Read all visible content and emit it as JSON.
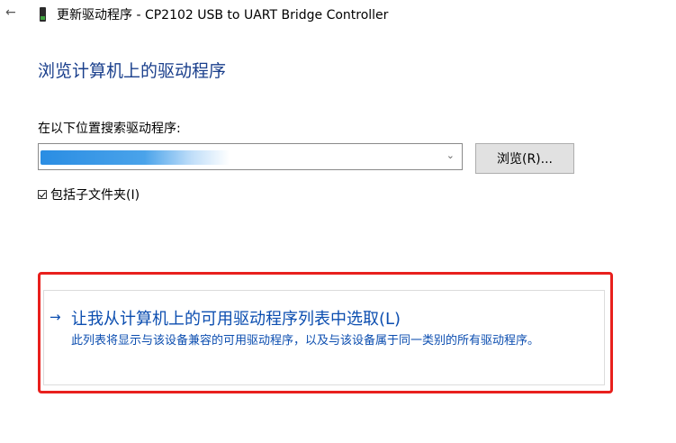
{
  "window": {
    "back_icon": "back-arrow-icon",
    "device_icon": "device-icon",
    "title": "更新驱动程序 - CP2102 USB to UART Bridge Controller"
  },
  "main": {
    "heading": "浏览计算机上的驱动程序",
    "search_label": "在以下位置搜索驱动程序:",
    "path_value": "",
    "browse_label": "浏览(R)...",
    "include_subfolders_label": "包括子文件夹(I)",
    "include_subfolders_checked": true
  },
  "option": {
    "title": "让我从计算机上的可用驱动程序列表中选取(L)",
    "description": "此列表将显示与该设备兼容的可用驱动程序，以及与该设备属于同一类别的所有驱动程序。"
  },
  "colors": {
    "heading": "#1a3f8c",
    "link": "#0c4eb0",
    "highlight": "#e8201d"
  }
}
